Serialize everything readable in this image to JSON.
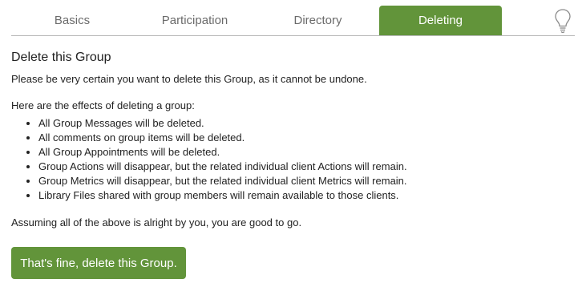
{
  "tabs": [
    {
      "label": "Basics",
      "active": false
    },
    {
      "label": "Participation",
      "active": false
    },
    {
      "label": "Directory",
      "active": false
    },
    {
      "label": "Deleting",
      "active": true
    }
  ],
  "help_icon": "lightbulb-icon",
  "section": {
    "title": "Delete this Group",
    "warning": "Please be very certain you want to delete this Group, as it cannot be undone.",
    "effects_intro": "Here are the effects of deleting a group:",
    "effects": [
      "All Group Messages will be deleted.",
      "All comments on group items will be deleted.",
      "All Group Appointments will be deleted.",
      "Group Actions will disappear, but the related individual client Actions will remain.",
      "Group Metrics will disappear, but the related individual client Metrics will remain.",
      "Library Files shared with group members will remain available to those clients."
    ],
    "assumption": "Assuming all of the above is alright by you, you are good to go.",
    "confirm_label": "That's fine, delete this Group."
  },
  "colors": {
    "accent": "#62943a",
    "tab_text": "#6b6b6b",
    "body_text": "#222222",
    "divider": "#b9b9b9"
  }
}
